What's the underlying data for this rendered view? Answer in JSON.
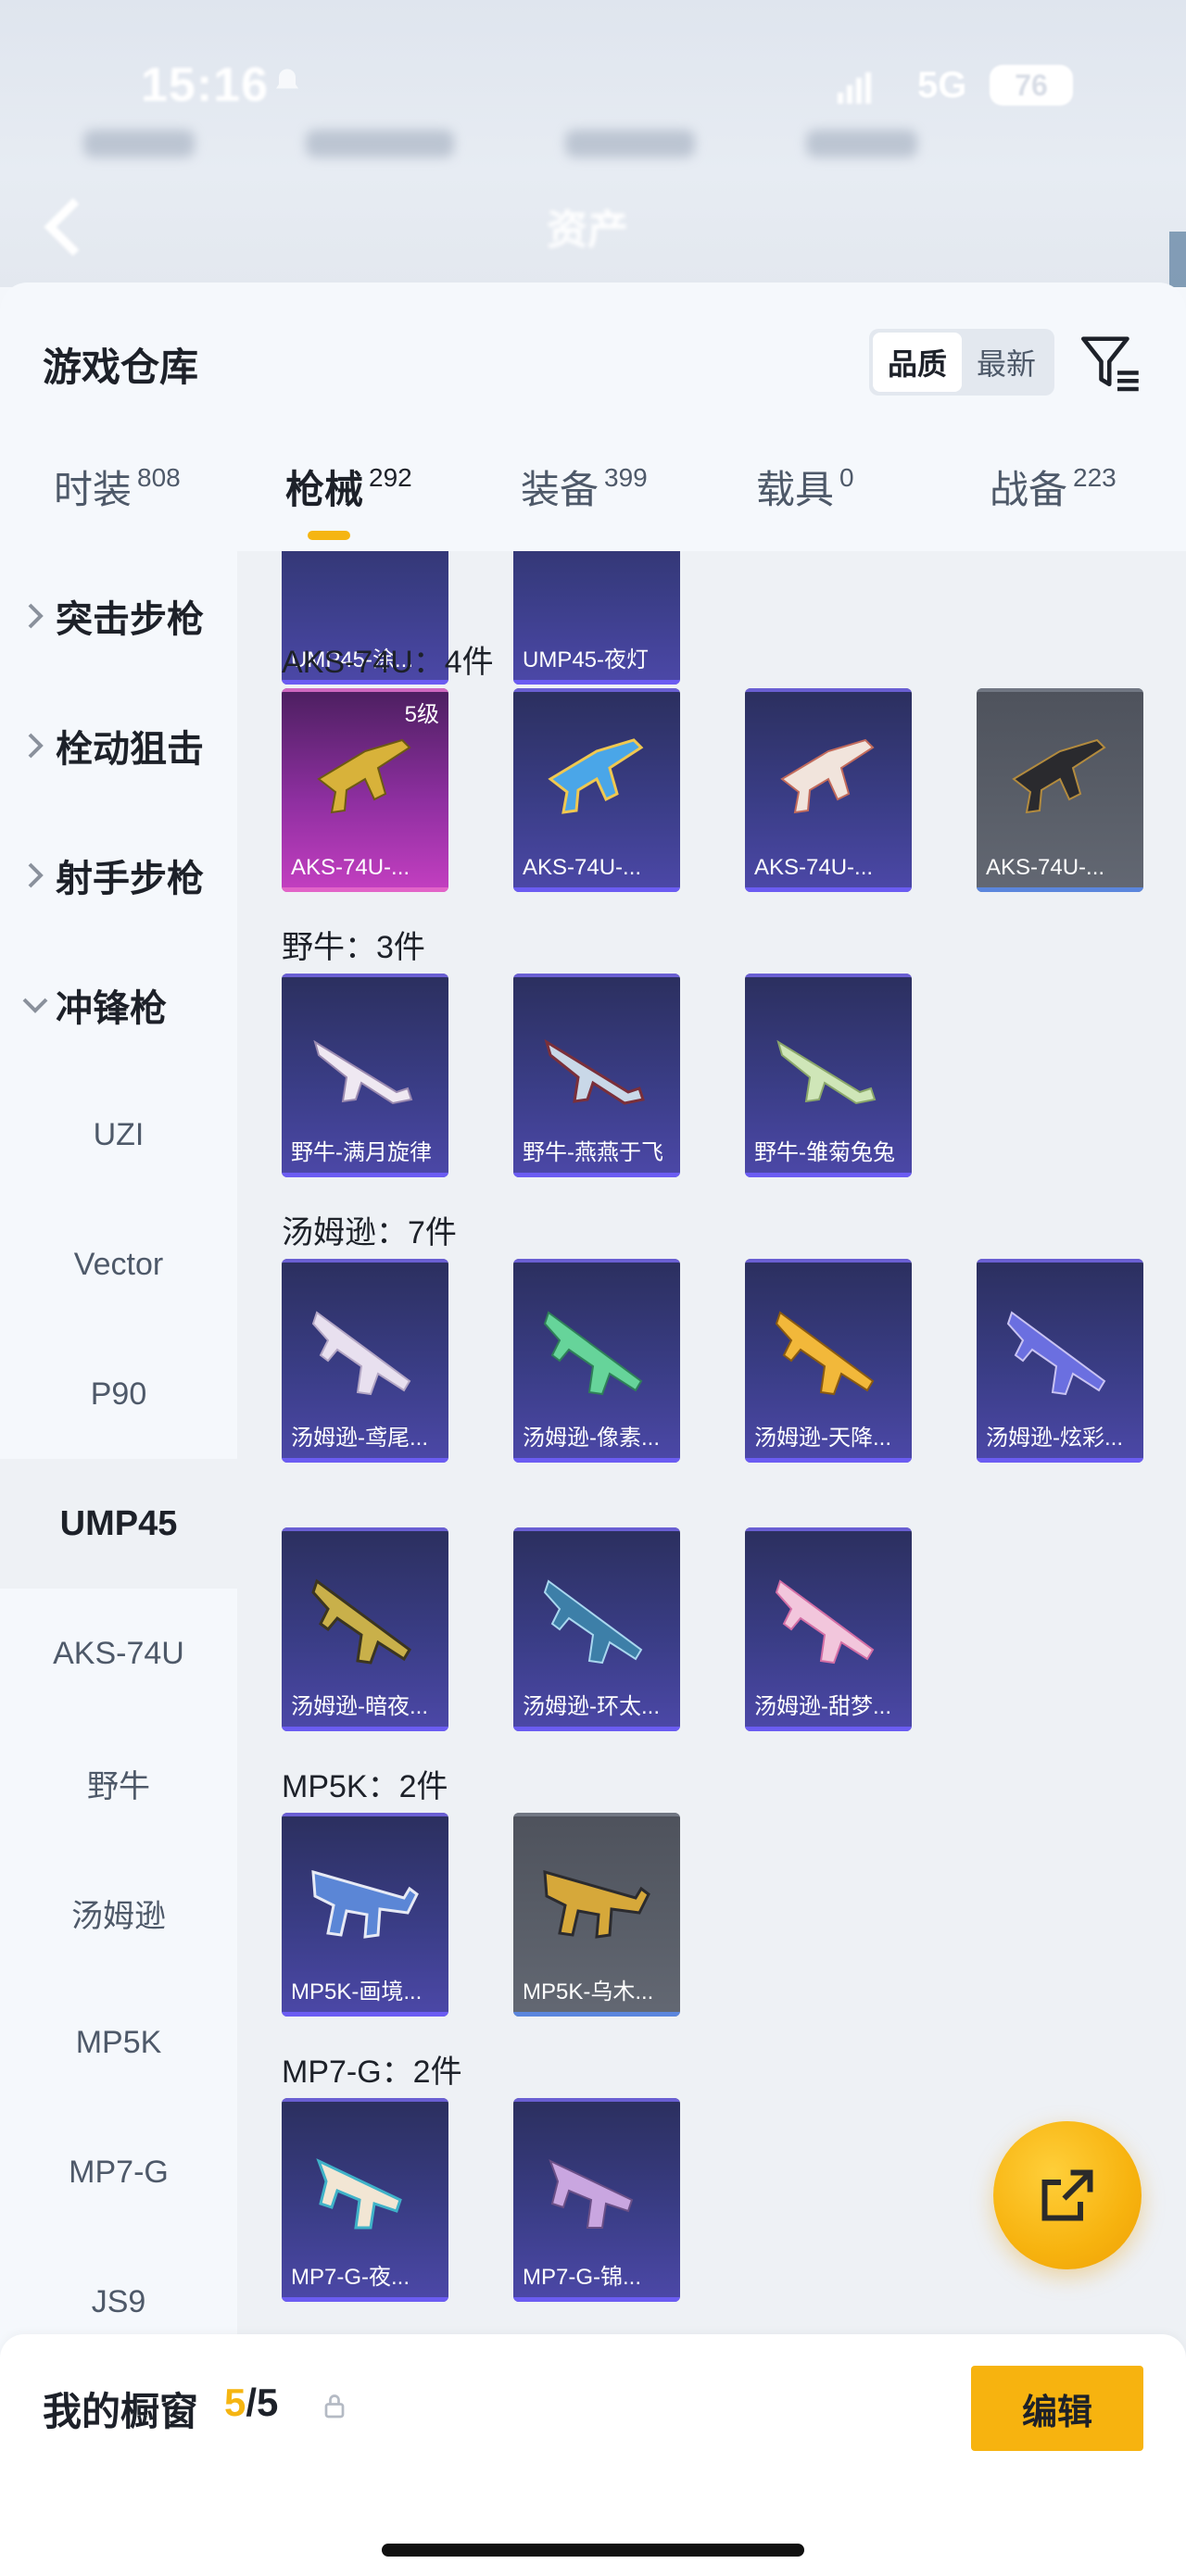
{
  "status_bar": {
    "time": "15:16",
    "network": "5G",
    "battery": "76"
  },
  "nav": {
    "title": "资产"
  },
  "panel": {
    "title": "游戏仓库",
    "sort_options": [
      "品质",
      "最新"
    ],
    "sort_active": "品质"
  },
  "tabs": [
    {
      "label": "时装",
      "count": "808"
    },
    {
      "label": "枪械",
      "count": "292"
    },
    {
      "label": "装备",
      "count": "399"
    },
    {
      "label": "载具",
      "count": "0"
    },
    {
      "label": "战备",
      "count": "223"
    }
  ],
  "sidebar": {
    "categories": [
      {
        "label": "突击步枪",
        "expanded": false
      },
      {
        "label": "栓动狙击",
        "expanded": false
      },
      {
        "label": "射手步枪",
        "expanded": false
      },
      {
        "label": "冲锋枪",
        "expanded": true
      }
    ],
    "subitems": [
      "UZI",
      "Vector",
      "P90",
      "UMP45",
      "AKS-74U",
      "野牛",
      "汤姆逊",
      "MP5K",
      "MP7-G",
      "JS9"
    ],
    "active_subitem": "UMP45"
  },
  "groups": [
    {
      "label": "",
      "items": [
        {
          "name": "UMP45-涂...",
          "rarity": "purple"
        },
        {
          "name": "UMP45-夜灯",
          "rarity": "purple"
        }
      ]
    },
    {
      "label": "AKS-74U：4件",
      "items": [
        {
          "name": "AKS-74U-...",
          "rarity": "pink",
          "level": "5级"
        },
        {
          "name": "AKS-74U-...",
          "rarity": "purple"
        },
        {
          "name": "AKS-74U-...",
          "rarity": "purple"
        },
        {
          "name": "AKS-74U-...",
          "rarity": "gray"
        }
      ]
    },
    {
      "label": "野牛：3件",
      "items": [
        {
          "name": "野牛-满月旋律",
          "rarity": "purple"
        },
        {
          "name": "野牛-燕燕于飞",
          "rarity": "purple"
        },
        {
          "name": "野牛-雏菊兔兔",
          "rarity": "purple"
        }
      ]
    },
    {
      "label": "汤姆逊：7件",
      "items": [
        {
          "name": "汤姆逊-鸢尾...",
          "rarity": "purple"
        },
        {
          "name": "汤姆逊-像素...",
          "rarity": "purple"
        },
        {
          "name": "汤姆逊-天降...",
          "rarity": "purple"
        },
        {
          "name": "汤姆逊-炫彩...",
          "rarity": "purple"
        },
        {
          "name": "汤姆逊-暗夜...",
          "rarity": "purple"
        },
        {
          "name": "汤姆逊-环太...",
          "rarity": "purple"
        },
        {
          "name": "汤姆逊-甜梦...",
          "rarity": "purple"
        }
      ]
    },
    {
      "label": "MP5K：2件",
      "items": [
        {
          "name": "MP5K-画境...",
          "rarity": "purple"
        },
        {
          "name": "MP5K-乌木...",
          "rarity": "gray"
        }
      ]
    },
    {
      "label": "MP7-G：2件",
      "items": [
        {
          "name": "MP7-G-夜...",
          "rarity": "purple"
        },
        {
          "name": "MP7-G-锦...",
          "rarity": "purple"
        }
      ]
    }
  ],
  "bottom": {
    "window_label": "我的橱窗",
    "count_current": "5",
    "count_total": "/5",
    "edit_label": "编辑"
  },
  "colors": {
    "accent": "#f7b30f",
    "purple_card": "#3a3d86",
    "gray_card": "#5a5f69",
    "pink_card": "#8e2fa0"
  }
}
